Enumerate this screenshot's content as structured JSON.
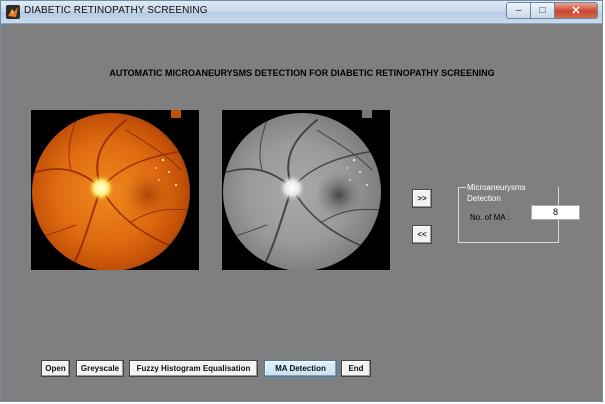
{
  "window": {
    "title": "DIABETIC RETINOPATHY SCREENING",
    "controls": {
      "minimize": "–",
      "maximize": "□",
      "close": "✕"
    }
  },
  "header": {
    "title": "AUTOMATIC MICROANEURYSMS DETECTION FOR DIABETIC RETINOPATHY SCREENING"
  },
  "images": {
    "original_icon": "retina-color-image",
    "processed_icon": "retina-greyscale-image"
  },
  "nav": {
    "forward_label": ">>",
    "back_label": "<<"
  },
  "detection_panel": {
    "title": "Microaneurysms Detection",
    "count_label": "No. of MA :",
    "count_value": "8"
  },
  "buttons": {
    "open": "Open",
    "greyscale": "Greyscale",
    "fuzzy": "Fuzzy Histogram Equalisation",
    "ma_detection": "MA Detection",
    "end": "End"
  },
  "colors": {
    "background": "#7f7f7f",
    "fundus_orange": "#e06a10",
    "active_button": "#c2e1f4"
  }
}
